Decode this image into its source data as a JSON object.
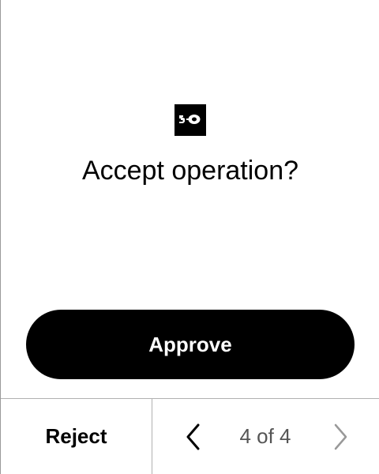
{
  "screen": {
    "title": "Accept operation?",
    "logo_icon": "tezos-xtz-icon"
  },
  "actions": {
    "approve_label": "Approve",
    "reject_label": "Reject"
  },
  "pager": {
    "current": 4,
    "total": 4,
    "text": "4 of 4",
    "prev_icon": "chevron-left-icon",
    "next_icon": "chevron-right-icon"
  },
  "colors": {
    "primary": "#000000",
    "background": "#ffffff",
    "on_primary": "#ffffff",
    "muted_text": "#555555",
    "disabled_icon": "#999999",
    "divider": "#b0b0b0"
  }
}
